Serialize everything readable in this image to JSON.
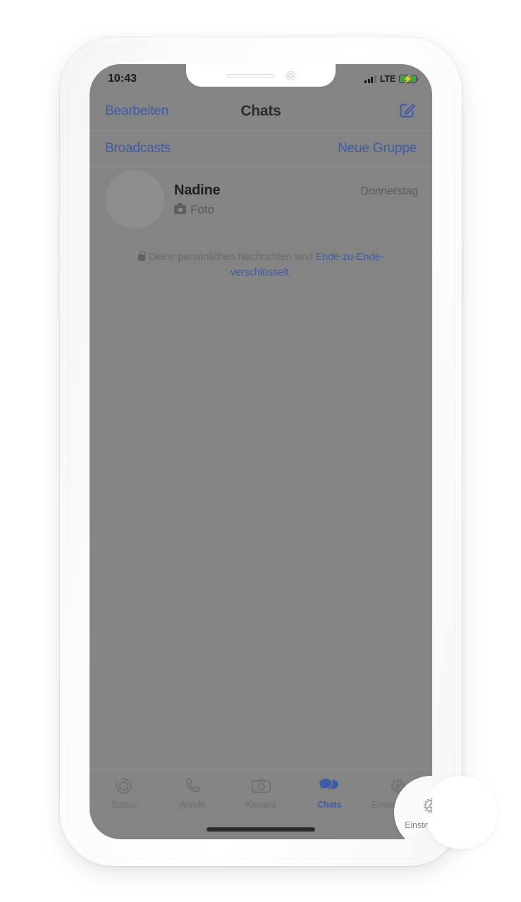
{
  "status_bar": {
    "time": "10:43",
    "network_label": "LTE",
    "signal_icon": "signal-bars-icon",
    "battery_icon": "battery-charging-icon",
    "charging_glyph": "⚡"
  },
  "nav_bar": {
    "left_action": "Bearbeiten",
    "title": "Chats",
    "compose_icon": "compose-icon"
  },
  "broadcast_bar": {
    "left_action": "Broadcasts",
    "right_action": "Neue Gruppe"
  },
  "chat_list": {
    "rows": [
      {
        "avatar_icon": "avatar-placeholder",
        "name": "Nadine",
        "preview_icon": "camera-icon",
        "preview": "Foto",
        "time": "Donnerstag"
      }
    ]
  },
  "encryption_notice": {
    "lock_icon": "lock-icon",
    "text_plain": "Deine persönlichen Nachrichten sind ",
    "text_link": "Ende-zu-Ende-verschlüsselt."
  },
  "tab_bar": {
    "items": [
      {
        "label": "Status",
        "icon": "status-rings-icon",
        "active": false
      },
      {
        "label": "Anrufe",
        "icon": "phone-icon",
        "active": false
      },
      {
        "label": "Kamera",
        "icon": "camera-icon",
        "active": false
      },
      {
        "label": "Chats",
        "icon": "chats-bubbles-icon",
        "active": true
      },
      {
        "label": "Einstellungen",
        "icon": "gear-icon",
        "active": false
      }
    ]
  },
  "highlight": {
    "target_label": "Einstellungen",
    "target_icon": "gear-icon"
  },
  "colors": {
    "accent_blue": "#3f5ca8",
    "screen_dim": "#848484",
    "battery_green": "#3ea33e",
    "frame_white": "#f7f7f8"
  },
  "hardware": {
    "speaker": "speaker-grille",
    "front_camera": "front-camera",
    "mute_switch": "mute-switch-button",
    "volume_up": "volume-up-button",
    "volume_down": "volume-down-button",
    "power": "power-button",
    "home_indicator": "home-indicator"
  }
}
